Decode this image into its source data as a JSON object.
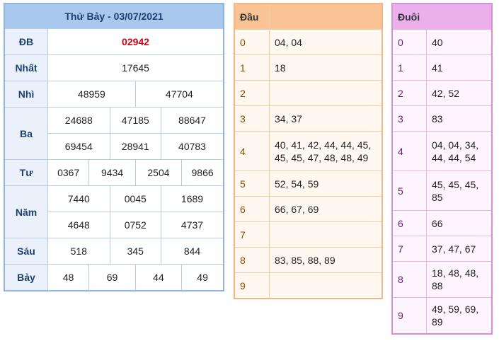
{
  "results": {
    "title": "Thứ Bảy - 03/07/2021",
    "prizes": [
      {
        "label": "ĐB",
        "numbers": [
          "02942"
        ]
      },
      {
        "label": "Nhất",
        "numbers": [
          "17645"
        ]
      },
      {
        "label": "Nhì",
        "numbers": [
          "48959",
          "47704"
        ]
      },
      {
        "label": "Ba",
        "numbers": [
          "24688",
          "47185",
          "88647",
          "69454",
          "28941",
          "40783"
        ]
      },
      {
        "label": "Tư",
        "numbers": [
          "0367",
          "9434",
          "2504",
          "9866"
        ]
      },
      {
        "label": "Năm",
        "numbers": [
          "7440",
          "0045",
          "1689",
          "4648",
          "0752",
          "4737"
        ]
      },
      {
        "label": "Sáu",
        "numbers": [
          "518",
          "345",
          "844"
        ]
      },
      {
        "label": "Bảy",
        "numbers": [
          "48",
          "69",
          "44",
          "49"
        ]
      }
    ]
  },
  "dau": {
    "title": "Đầu",
    "rows": [
      {
        "key": "0",
        "value": "04, 04"
      },
      {
        "key": "1",
        "value": "18"
      },
      {
        "key": "2",
        "value": ""
      },
      {
        "key": "3",
        "value": "34, 37"
      },
      {
        "key": "4",
        "value": "40, 41, 42, 44, 44, 45, 45, 45, 47, 48, 48, 49"
      },
      {
        "key": "5",
        "value": "52, 54, 59"
      },
      {
        "key": "6",
        "value": "66, 67, 69"
      },
      {
        "key": "7",
        "value": ""
      },
      {
        "key": "8",
        "value": "83, 85, 88, 89"
      },
      {
        "key": "9",
        "value": ""
      }
    ]
  },
  "duoi": {
    "title": "Đuôi",
    "rows": [
      {
        "key": "0",
        "value": "40"
      },
      {
        "key": "1",
        "value": "41"
      },
      {
        "key": "2",
        "value": "42, 52"
      },
      {
        "key": "3",
        "value": "83"
      },
      {
        "key": "4",
        "value": "04, 04, 34, 44, 44, 54"
      },
      {
        "key": "5",
        "value": "45, 45, 45, 85"
      },
      {
        "key": "6",
        "value": "66"
      },
      {
        "key": "7",
        "value": "37, 47, 67"
      },
      {
        "key": "8",
        "value": "18, 48, 48, 88"
      },
      {
        "key": "9",
        "value": "49, 59, 69, 89"
      }
    ]
  }
}
